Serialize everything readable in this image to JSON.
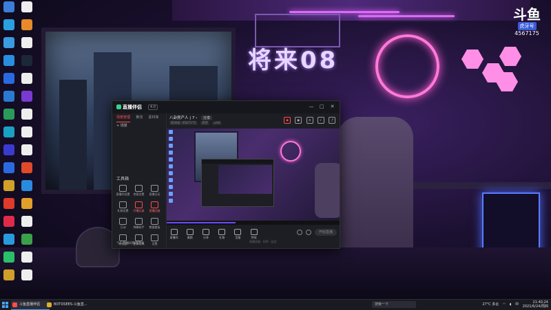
{
  "colors": {
    "accent_red": "#ff4d4d",
    "neon_pink": "#ff7ad9",
    "taskbar_bg": "#1a1b22"
  },
  "wallpaper": {
    "sign_text": "将来08"
  },
  "brand_overlay": {
    "name": "斗鱼",
    "badge": "虎牙号",
    "number": "4567175"
  },
  "desktop_icons": [
    {
      "label": "",
      "icon": "globe-icon",
      "color": "#3b7dd8"
    },
    {
      "label": "",
      "icon": "file-icon",
      "color": "#eee"
    },
    {
      "label": "",
      "icon": "edge-icon",
      "color": "#2aa0e0"
    },
    {
      "label": "",
      "icon": "app-icon",
      "color": "#e88a2a"
    },
    {
      "label": "",
      "icon": "app-icon",
      "color": "#3a9be0"
    },
    {
      "label": "",
      "icon": "file-icon",
      "color": "#eee"
    },
    {
      "label": "",
      "icon": "ie-icon",
      "color": "#2a8ee0"
    },
    {
      "label": "",
      "icon": "steam-icon",
      "color": "#1b2838"
    },
    {
      "label": "",
      "icon": "app-icon",
      "color": "#2a6ae0"
    },
    {
      "label": "",
      "icon": "file-icon",
      "color": "#eee"
    },
    {
      "label": "",
      "icon": "app-icon",
      "color": "#2a7ad0"
    },
    {
      "label": "",
      "icon": "app-icon",
      "color": "#7a3ad0"
    },
    {
      "label": "",
      "icon": "app-icon",
      "color": "#2a9a5a"
    },
    {
      "label": "",
      "icon": "file-icon",
      "color": "#eee"
    },
    {
      "label": "",
      "icon": "edge-icon",
      "color": "#1aa0c0"
    },
    {
      "label": "",
      "icon": "file-icon",
      "color": "#eee"
    },
    {
      "label": "",
      "icon": "app-icon",
      "color": "#3a3ad0"
    },
    {
      "label": "",
      "icon": "file-icon",
      "color": "#eee"
    },
    {
      "label": "",
      "icon": "app-icon",
      "color": "#2a6ae0"
    },
    {
      "label": "",
      "icon": "app-icon",
      "color": "#e04a2a"
    },
    {
      "label": "",
      "icon": "app-icon",
      "color": "#d0a02a"
    },
    {
      "label": "",
      "icon": "app-icon",
      "color": "#2a8ae0"
    },
    {
      "label": "",
      "icon": "app-icon",
      "color": "#e03a2a"
    },
    {
      "label": "",
      "icon": "app-icon",
      "color": "#e0a02a"
    },
    {
      "label": "",
      "icon": "app-icon",
      "color": "#e02a4a"
    },
    {
      "label": "",
      "icon": "file-icon",
      "color": "#eee"
    },
    {
      "label": "",
      "icon": "app-icon",
      "color": "#2a9ae0"
    },
    {
      "label": "",
      "icon": "app-icon",
      "color": "#3aa04a"
    },
    {
      "label": "",
      "icon": "app-icon",
      "color": "#2ac06a"
    },
    {
      "label": "",
      "icon": "file-icon",
      "color": "#eee"
    },
    {
      "label": "",
      "icon": "app-icon",
      "color": "#d0a02a"
    },
    {
      "label": "",
      "icon": "file-icon",
      "color": "#eee"
    }
  ],
  "app": {
    "title": "直播伴侣",
    "version": "4.0",
    "window_controls": [
      "—",
      "□",
      "✕"
    ],
    "tabs": [
      "场景管理",
      "推流",
      "素材库"
    ],
    "scene_label": "+ 场景",
    "tools_title": "工具箱",
    "tools": [
      {
        "label": "直播间设置",
        "red": false
      },
      {
        "label": "房管设置",
        "red": false
      },
      {
        "label": "直播日历",
        "red": false
      },
      {
        "label": "礼物设置",
        "red": false
      },
      {
        "label": "开播记录",
        "red": true
      },
      {
        "label": "直播回放",
        "red": true
      },
      {
        "label": "互动",
        "red": false
      },
      {
        "label": "弹幕助手",
        "red": false
      },
      {
        "label": "数据看板",
        "red": false
      },
      {
        "label": "粉丝团",
        "red": false
      },
      {
        "label": "更多工具",
        "red": false
      },
      {
        "label": "设置",
        "red": false
      }
    ],
    "left_footer": "个人直播间管理面板",
    "stream": {
      "title": "八卦房产人 | 7 ›",
      "tag_button": "分享",
      "meta": [
        "房间号: 4567175",
        "虎牙",
        "LIVE"
      ]
    },
    "bottom_buttons": [
      "直播间",
      "美颜",
      "分享",
      "礼物",
      "音量",
      "特效"
    ],
    "bottom_sub": "直播质量 · 码率 · 延迟",
    "go_live": "开始直播"
  },
  "taskbar": {
    "apps": [
      {
        "label": "斗鱼直播伴侣",
        "active": true,
        "color": "#ff4d4d"
      },
      {
        "label": "BOTOSEES-斗鱼直...",
        "active": false,
        "color": "#e0b02a"
      }
    ],
    "search_placeholder": "搜索一下",
    "weather": "27°C 多云",
    "time": "21:40:24",
    "date": "2021/6/24/周四",
    "lang": "中"
  }
}
